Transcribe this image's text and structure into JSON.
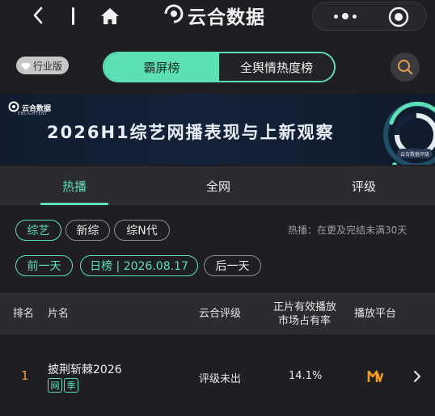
{
  "app": {
    "title": "云合数据",
    "colors": {
      "accent": "#5de0b6",
      "background": "#1f1f23",
      "rank": "#f0a23a",
      "platform": "#f39a1e"
    }
  },
  "nav": {
    "back_icon": "chevron-left-icon",
    "home_icon": "home-icon",
    "logo_icon": "yunhe-logo-icon",
    "more_icon": "more-dots-icon",
    "close_icon": "target-close-icon"
  },
  "segment": {
    "edition_label": "行业版",
    "edition_icon": "diamond-icon",
    "options": [
      "霸屏榜",
      "全舆情热度榜"
    ],
    "selected": "霸屏榜",
    "search_icon": "search-icon"
  },
  "banner": {
    "logo_text": "云合数据",
    "logo_sub": "ENLIGHTENT",
    "title": "2026H1综艺网播表现与上新观察",
    "badge": "云合数据评级"
  },
  "tabs": [
    "热播",
    "全网",
    "评级"
  ],
  "active_tab": "热播",
  "filters": {
    "categories": [
      "综艺",
      "新综",
      "综N代"
    ],
    "selected_category": "综艺",
    "note": "热播：在更及完结未满30天",
    "prev_day": "前一天",
    "current_date": "日榜 | 2026.08.17",
    "next_day": "后一天"
  },
  "table": {
    "headers": {
      "rank": "排名",
      "name": "片名",
      "rating": "云合评级",
      "share_line1": "正片有效播放",
      "share_line2": "市场占有率",
      "platform": "播放平台"
    },
    "rows": [
      {
        "rank": "1",
        "name": "披荆斩棘2026",
        "tags": [
          "网",
          "季"
        ],
        "rating": "评级未出",
        "share": "14.1%",
        "platform_icon": "mango-tv-icon"
      }
    ]
  }
}
